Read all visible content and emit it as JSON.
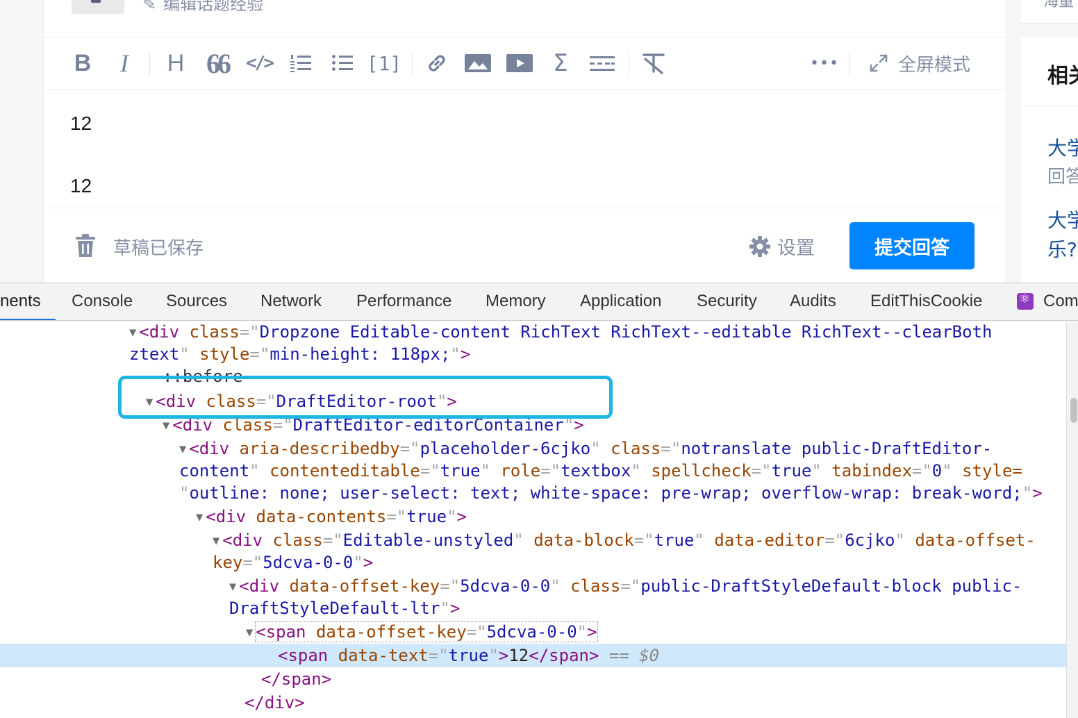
{
  "page": {
    "edit_topic_label": "编辑话题经验",
    "editor_lines": [
      "12",
      "12"
    ],
    "draft_status": "草稿已保存",
    "settings_label": "设置",
    "submit_label": "提交回答",
    "fullscreen_label": "全屏模式",
    "toolbar_icons": [
      "bold-icon",
      "italic-icon",
      "heading-icon",
      "quote-icon",
      "code-icon",
      "ordered-list-icon",
      "unordered-list-icon",
      "reference-icon",
      "link-icon",
      "image-icon",
      "video-icon",
      "formula-icon",
      "divider-icon",
      "clear-format-icon",
      "more-icon",
      "fullscreen-icon"
    ],
    "toolbar_labels": {
      "bold": "B",
      "italic": "I",
      "heading": "H",
      "quote": "66",
      "code": "</>",
      "reference": "[1]",
      "formula": "Σ",
      "more": "•••"
    },
    "sidebar": {
      "top_text": "海量",
      "title": "相关",
      "items": [
        {
          "title": "大学",
          "meta": "回答"
        },
        {
          "title": "大学",
          "meta": "乐?"
        }
      ]
    }
  },
  "devtools": {
    "tabs": [
      "nents",
      "Console",
      "Sources",
      "Network",
      "Performance",
      "Memory",
      "Application",
      "Security",
      "Audits",
      "EditThisCookie",
      "Com"
    ],
    "active_tab": "nents",
    "colors": {
      "tag": "#881280",
      "attr": "#994500",
      "value": "#1a1aa6",
      "selection": "#cfe8fc",
      "highlight": "#1fb6e4"
    },
    "dom": {
      "l1": {
        "open": "<",
        "tag": "div",
        "a1": "class",
        "v1": "Dropzone Editable-content RichText RichText--editable RichText--clearBoth",
        "close": ""
      },
      "l1b": {
        "v1": "ztext",
        "a2": "style",
        "v2": "min-height: 118px;"
      },
      "before": "::before",
      "l2": {
        "tag": "div",
        "a1": "class",
        "v1": "DraftEditor-root"
      },
      "l3": {
        "tag": "div",
        "a1": "class",
        "v1": "DraftEditor-editorContainer"
      },
      "l4": {
        "tag": "div",
        "a1": "aria-describedby",
        "v1": "placeholder-6cjko",
        "a2": "class",
        "v2": "notranslate public-DraftEditor-"
      },
      "l4b": {
        "v2": "content",
        "a3": "contenteditable",
        "v3": "true",
        "a4": "role",
        "v4": "textbox",
        "a5": "spellcheck",
        "v5": "true",
        "a6": "tabindex",
        "v6": "0",
        "a7": "style="
      },
      "l4c": {
        "v7": "outline: none; user-select: text; white-space: pre-wrap; overflow-wrap: break-word;"
      },
      "l5": {
        "tag": "div",
        "a1": "data-contents",
        "v1": "true"
      },
      "l6": {
        "tag": "div",
        "a1": "class",
        "v1": "Editable-unstyled",
        "a2": "data-block",
        "v2": "true",
        "a3": "data-editor",
        "v3": "6cjko",
        "a4": "data-offset-"
      },
      "l6b": {
        "a4": "key",
        "v4": "5dcva-0-0"
      },
      "l7": {
        "tag": "div",
        "a1": "data-offset-key",
        "v1": "5dcva-0-0",
        "a2": "class",
        "v2": "public-DraftStyleDefault-block public-"
      },
      "l7b": {
        "v2": "DraftStyleDefault-ltr"
      },
      "l8": {
        "tag": "span",
        "a1": "data-offset-key",
        "v1": "5dcva-0-0"
      },
      "l9": {
        "tag": "span",
        "a1": "data-text",
        "v1": "true",
        "text": "12",
        "eq": "== $0"
      },
      "l10": {
        "tag": "span"
      },
      "l11": {
        "tag": "div"
      }
    }
  }
}
